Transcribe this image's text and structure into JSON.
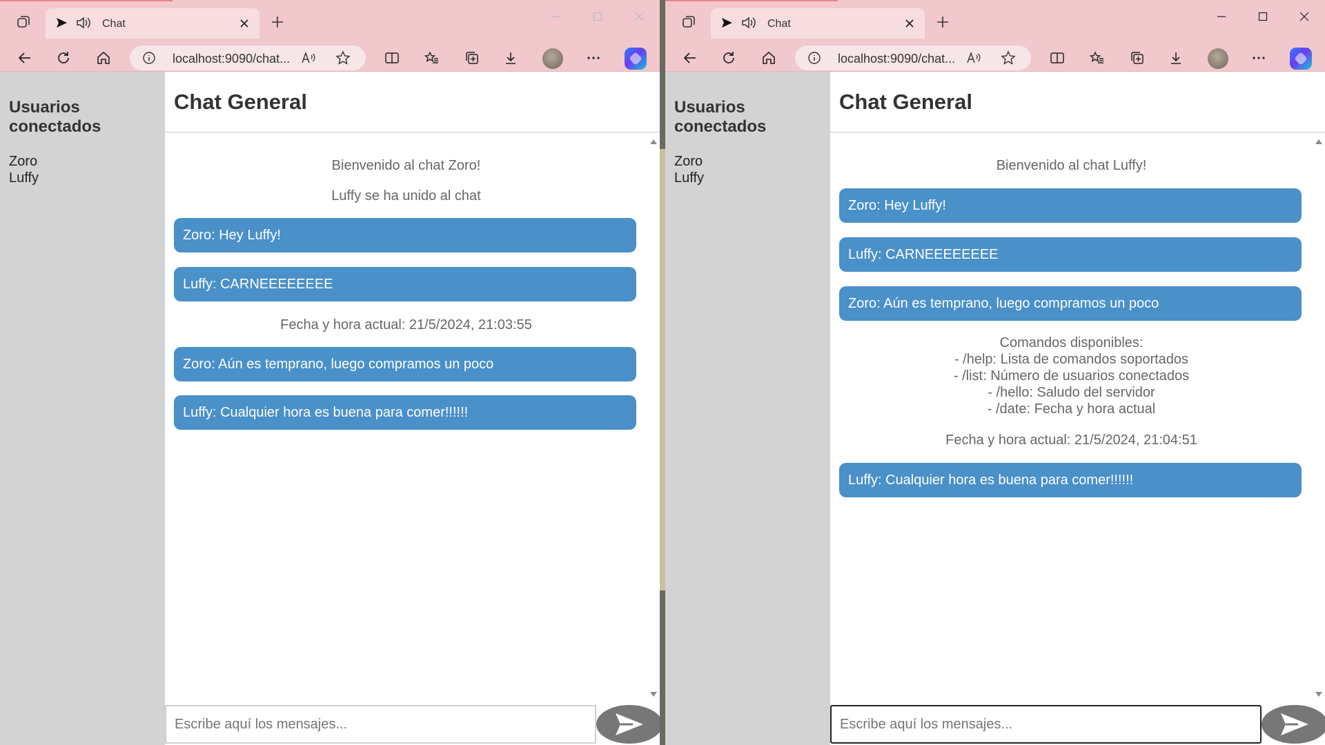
{
  "windows": [
    {
      "tab_title": "Chat",
      "url": "localhost:9090/chat...",
      "sidebar_title": "Usuarios conectados",
      "users": [
        "Zoro",
        "Luffy"
      ],
      "chat_title": "Chat General",
      "messages": [
        {
          "type": "system",
          "text": "Bienvenido al chat Zoro!"
        },
        {
          "type": "system",
          "text": "Luffy se ha unido al chat"
        },
        {
          "type": "user",
          "text": "Zoro: Hey Luffy!"
        },
        {
          "type": "user",
          "text": "Luffy: CARNEEEEEEEE"
        },
        {
          "type": "system",
          "text": "Fecha y hora actual: 21/5/2024, 21:03:55"
        },
        {
          "type": "user",
          "text": "Zoro: Aún es temprano, luego compramos un poco"
        },
        {
          "type": "user",
          "text": "Luffy: Cualquier hora es buena para comer!!!!!!"
        }
      ],
      "input_placeholder": "Escribe aquí los mensajes..."
    },
    {
      "tab_title": "Chat",
      "url": "localhost:9090/chat...",
      "sidebar_title": "Usuarios conectados",
      "users": [
        "Zoro",
        "Luffy"
      ],
      "chat_title": "Chat General",
      "messages": [
        {
          "type": "system",
          "text": "Bienvenido al chat Luffy!"
        },
        {
          "type": "user",
          "text": "Zoro: Hey Luffy!"
        },
        {
          "type": "user",
          "text": "Luffy: CARNEEEEEEEE"
        },
        {
          "type": "user",
          "text": "Zoro: Aún es temprano, luego compramos un poco"
        },
        {
          "type": "system",
          "lines": [
            "Comandos disponibles:",
            "- /help: Lista de comandos soportados",
            "- /list: Número de usuarios conectados",
            "- /hello: Saludo del servidor",
            "- /date: Fecha y hora actual"
          ]
        },
        {
          "type": "system",
          "text": "Fecha y hora actual: 21/5/2024, 21:04:51"
        },
        {
          "type": "user",
          "text": "Luffy: Cualquier hora es buena para comer!!!!!!"
        }
      ],
      "input_placeholder": "Escribe aquí los mensajes..."
    }
  ],
  "colors": {
    "browser_chrome": "#f1c8cc",
    "sidebar_bg": "#d3d3d3",
    "bubble_bg": "#4a90c9",
    "send_button": "#777777"
  },
  "icons": [
    "tab-actions-icon",
    "play-icon",
    "speaker-icon",
    "close-icon",
    "plus-icon",
    "minimize-icon",
    "maximize-icon",
    "back-icon",
    "refresh-icon",
    "home-icon",
    "info-icon",
    "read-aloud-icon",
    "star-icon",
    "split-screen-icon",
    "favorites-icon",
    "collections-icon",
    "download-icon",
    "more-icon",
    "copilot-icon",
    "send-arrow-icon"
  ]
}
